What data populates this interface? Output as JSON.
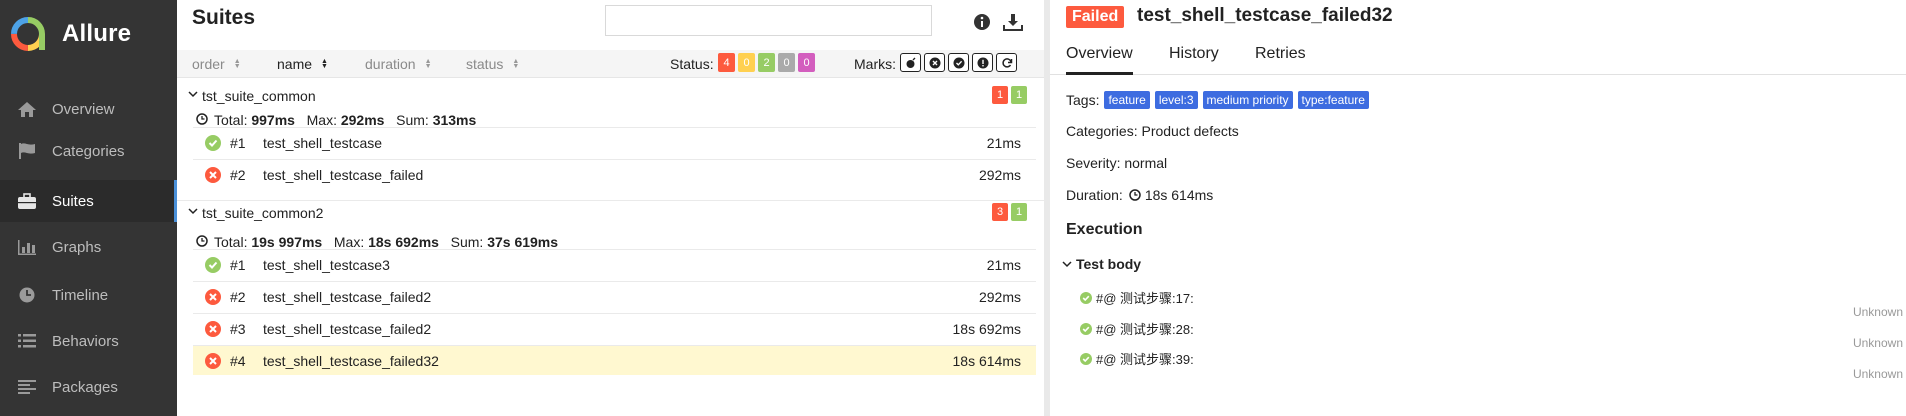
{
  "app": {
    "name": "Allure"
  },
  "sidebar": {
    "items": [
      {
        "label": "Overview",
        "icon": "home-icon"
      },
      {
        "label": "Categories",
        "icon": "flag-icon"
      },
      {
        "label": "Suites",
        "icon": "briefcase-icon",
        "active": true
      },
      {
        "label": "Graphs",
        "icon": "bar-chart-icon"
      },
      {
        "label": "Timeline",
        "icon": "clock-icon"
      },
      {
        "label": "Behaviors",
        "icon": "list-icon"
      },
      {
        "label": "Packages",
        "icon": "align-left-icon"
      }
    ]
  },
  "suites": {
    "title": "Suites",
    "search": {
      "value": "",
      "placeholder": ""
    },
    "sort": {
      "order": "order",
      "name": "name",
      "duration": "duration",
      "status": "status"
    },
    "status_label": "Status:",
    "status_counts": {
      "failed": "4",
      "broken": "0",
      "passed": "2",
      "skipped": "0",
      "unknown": "0"
    },
    "marks_label": "Marks:",
    "groups": [
      {
        "name": "tst_suite_common",
        "failed": "1",
        "passed": "1",
        "stats": {
          "total_label": "Total:",
          "total": "997ms",
          "max_label": "Max:",
          "max": "292ms",
          "sum_label": "Sum:",
          "sum": "313ms"
        },
        "rows": [
          {
            "status": "passed",
            "num": "#1",
            "name": "test_shell_testcase",
            "duration": "21ms"
          },
          {
            "status": "failed",
            "num": "#2",
            "name": "test_shell_testcase_failed",
            "duration": "292ms"
          }
        ]
      },
      {
        "name": "tst_suite_common2",
        "failed": "3",
        "passed": "1",
        "stats": {
          "total_label": "Total:",
          "total": "19s 997ms",
          "max_label": "Max:",
          "max": "18s 692ms",
          "sum_label": "Sum:",
          "sum": "37s 619ms"
        },
        "rows": [
          {
            "status": "passed",
            "num": "#1",
            "name": "test_shell_testcase3",
            "duration": "21ms"
          },
          {
            "status": "failed",
            "num": "#2",
            "name": "test_shell_testcase_failed2",
            "duration": "292ms"
          },
          {
            "status": "failed",
            "num": "#3",
            "name": "test_shell_testcase_failed2",
            "duration": "18s 692ms"
          },
          {
            "status": "failed",
            "num": "#4",
            "name": "test_shell_testcase_failed32",
            "duration": "18s 614ms",
            "selected": true
          }
        ]
      }
    ]
  },
  "detail": {
    "status": "Failed",
    "title": "test_shell_testcase_failed32",
    "tabs": [
      "Overview",
      "History",
      "Retries"
    ],
    "tags_label": "Tags:",
    "tags": [
      "feature",
      "level:3",
      "medium priority",
      "type:feature"
    ],
    "categories": "Categories: Product defects",
    "severity": "Severity: normal",
    "duration_label": "Duration:",
    "duration": "18s 614ms",
    "execution_title": "Execution",
    "test_body": "Test body",
    "steps": [
      {
        "label": "#@ 测试步骤:17:",
        "status": "Unknown"
      },
      {
        "label": "#@ 测试步骤:28:",
        "status": "Unknown"
      },
      {
        "label": "#@ 测试步骤:39:",
        "status": "Unknown"
      }
    ]
  },
  "colors": {
    "sidebar_bg": "#343434",
    "failed": "#fd5a3e",
    "broken": "#ffd050",
    "passed": "#97cc64",
    "skipped": "#aaaaaa",
    "unknown": "#d35ebe",
    "tag": "#3d6ce0",
    "selected_row": "#fff8d0"
  }
}
